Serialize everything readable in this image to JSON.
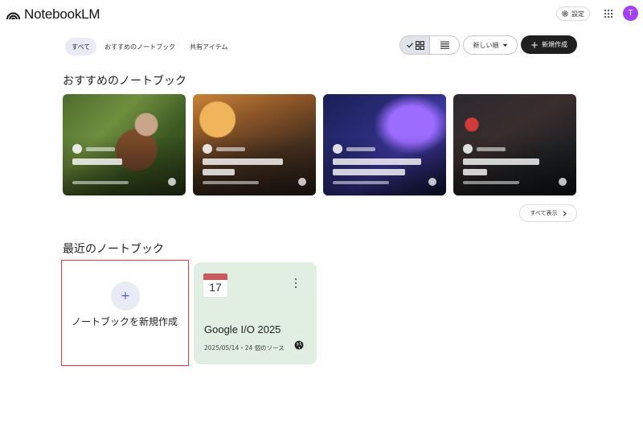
{
  "header": {
    "app_name": "NotebookLM",
    "settings_label": "設定",
    "avatar_initial": "T"
  },
  "filters": {
    "tabs": [
      {
        "label": "すべて",
        "active": true
      },
      {
        "label": "おすすめのノートブック",
        "active": false
      },
      {
        "label": "共有アイテム",
        "active": false
      }
    ]
  },
  "toolbar": {
    "view_mode": "grid",
    "sort_label": "新しい順",
    "new_label": "新規作成"
  },
  "featured": {
    "title": "おすすめのノートブック",
    "show_all_label": "すべて表示"
  },
  "recent": {
    "title": "最近のノートブック",
    "create_label": "ノートブックを新規作成",
    "notebooks": [
      {
        "icon": "calendar-icon",
        "calendar_day": "17",
        "title": "Google I/O 2025",
        "meta": "2025/05/14・24 個のソース"
      }
    ]
  },
  "colors": {
    "primary_button": "#1f1f1f",
    "active_tab": "#e8eaf6",
    "notebook_card": "#e0efe2",
    "avatar": "#a142f4",
    "highlight_border": "#e53935"
  }
}
